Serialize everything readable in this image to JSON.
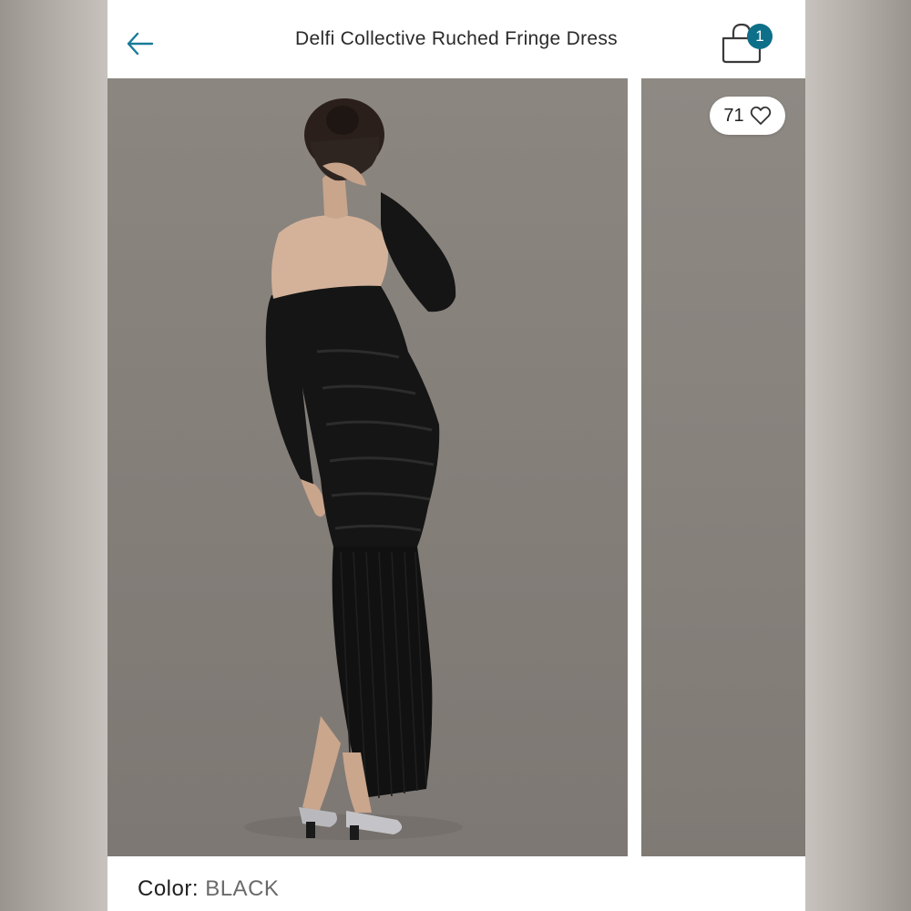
{
  "header": {
    "title": "Delfi Collective Ruched Fringe Dress",
    "cart_count": "1"
  },
  "gallery": {
    "like_count": "71"
  },
  "product": {
    "color_label": "Color:",
    "color_value": "BLACK"
  },
  "colors": {
    "accent": "#0e6f88",
    "backdrop": "#87817c",
    "dress": "#151515"
  },
  "icons": {
    "back": "arrow-left-icon",
    "cart": "shopping-bag-icon",
    "like": "heart-outline-icon"
  }
}
